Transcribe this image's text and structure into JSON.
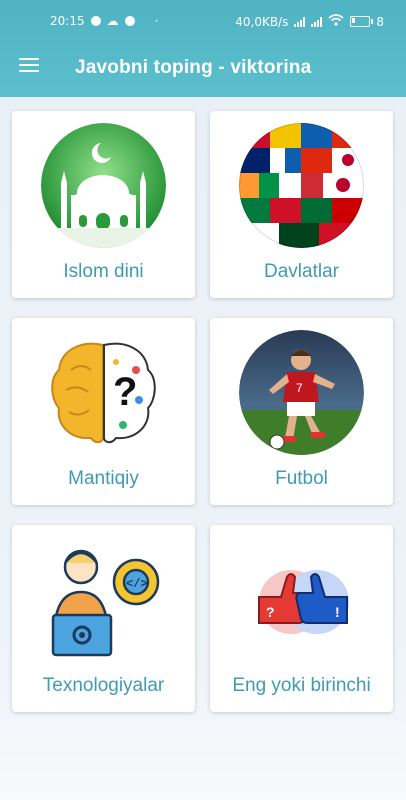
{
  "status": {
    "time": "20:15",
    "network_speed": "40,0KB/s",
    "battery_percent": "8"
  },
  "header": {
    "title": "Javobni toping - viktorina",
    "menu_icon": "hamburger-menu-icon",
    "background_color": "#58bccb"
  },
  "categories": [
    {
      "label": "Islom dini",
      "icon": "mosque-icon"
    },
    {
      "label": "Davlatlar",
      "icon": "flags-globe-icon"
    },
    {
      "label": "Mantiqiy",
      "icon": "brain-icon"
    },
    {
      "label": "Futbol",
      "icon": "football-player-icon"
    },
    {
      "label": "Texnologiyalar",
      "icon": "programmer-icon"
    },
    {
      "label": "Eng yoki birinchi",
      "icon": "thumbs-vote-icon"
    }
  ],
  "accent_color": "#3f9bb4"
}
